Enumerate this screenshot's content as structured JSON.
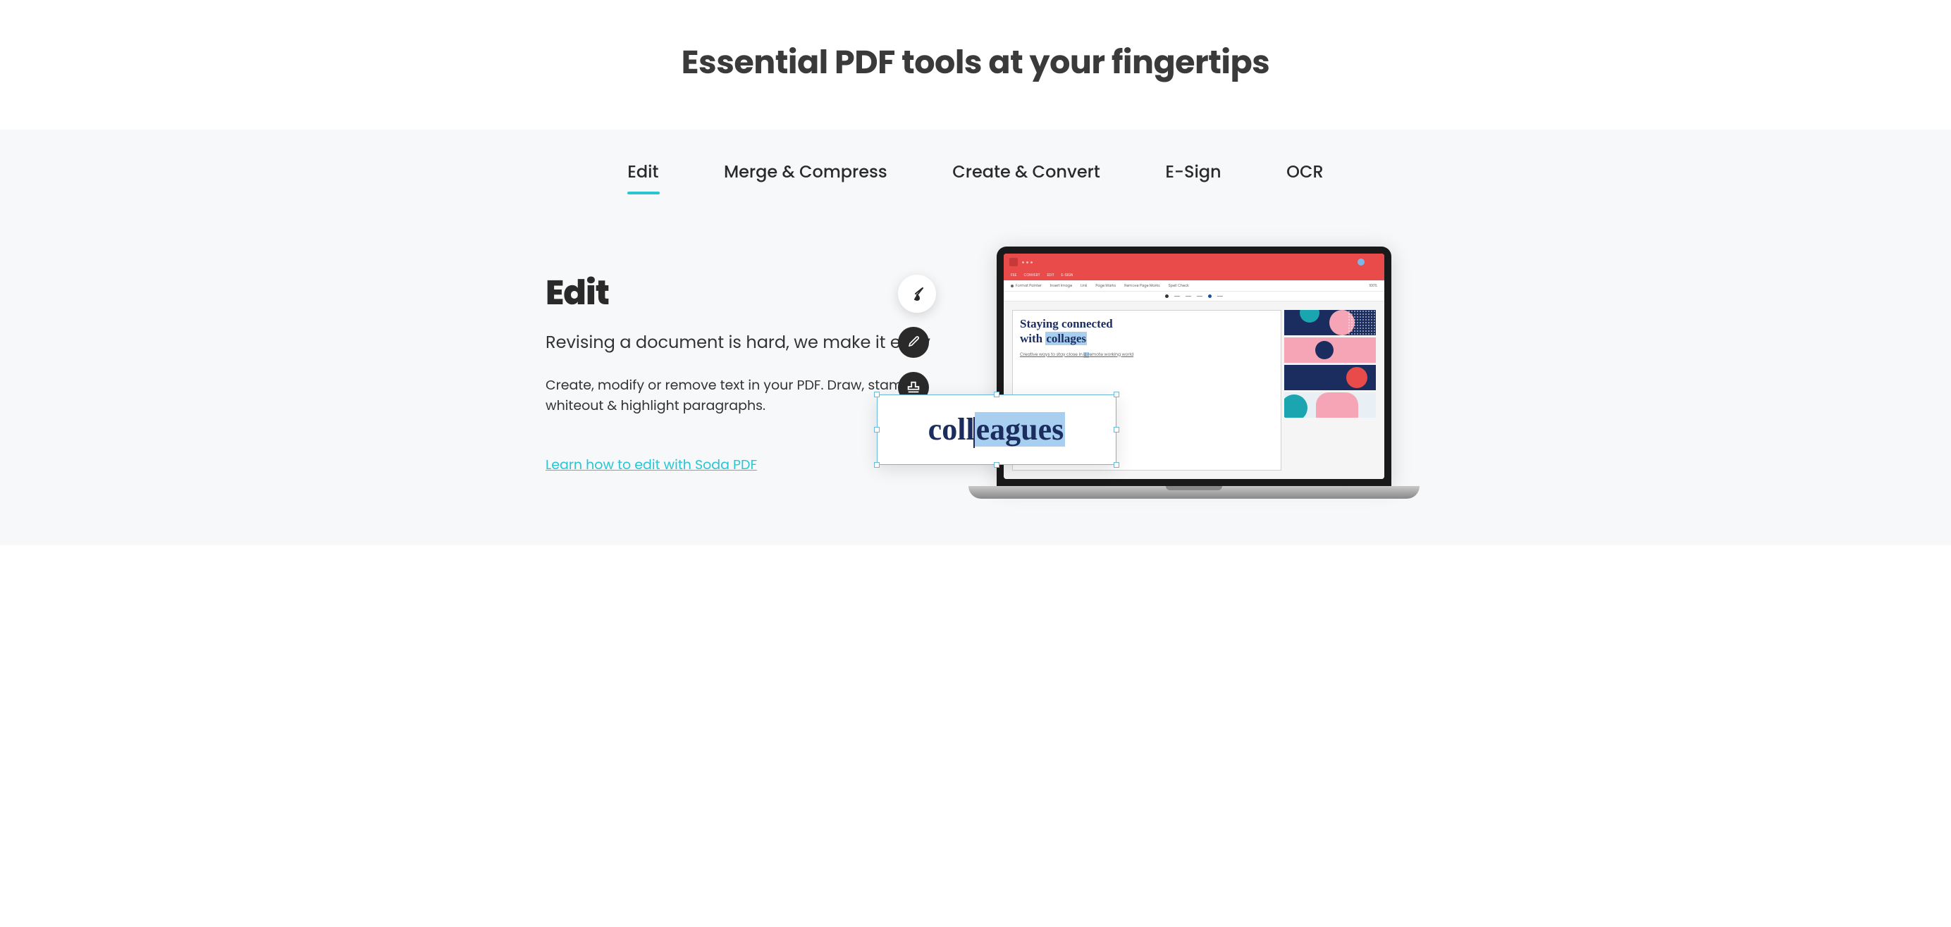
{
  "hero": {
    "title": "Essential PDF tools at your fingertips"
  },
  "tabs": [
    {
      "label": "Edit",
      "active": true
    },
    {
      "label": "Merge & Compress",
      "active": false
    },
    {
      "label": "Create & Convert",
      "active": false
    },
    {
      "label": "E-Sign",
      "active": false
    },
    {
      "label": "OCR",
      "active": false
    }
  ],
  "feature": {
    "title": "Edit",
    "subtitle": "Revising a document is hard, we make it easy",
    "description": "Create, modify or remove text in your PDF. Draw, stamp, whiteout & highlight paragraphs.",
    "link_text": "Learn how to edit with Soda PDF"
  },
  "mock": {
    "headline_line1": "Staying connected",
    "headline_line2_prefix": "with ",
    "headline_line2_highlight": "collages",
    "subtext_prefix": "Creative ways to stay close in ",
    "subtext_highlight": "a r",
    "subtext_suffix": "emote working world",
    "edit_word_prefix": "coll",
    "edit_word_highlight": "eagues",
    "toolbar_items": [
      "Format Painter",
      "Insert Image",
      "Link",
      "Page Marks",
      "Remove Page Marks",
      "Spell Check"
    ],
    "zoom": "100%"
  }
}
